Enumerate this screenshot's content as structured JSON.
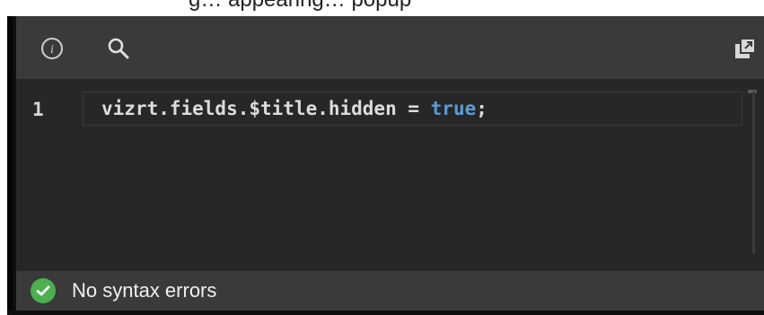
{
  "top_strip": {
    "text": "g… appearing… popup"
  },
  "toolbar": {
    "info_icon": "info-icon",
    "search_icon": "search-icon",
    "popout_icon": "popout-icon"
  },
  "editor": {
    "line_numbers": [
      "1"
    ],
    "code": {
      "prefix": "vizrt.fields.$title.hidden = ",
      "keyword": "true",
      "suffix": ";"
    }
  },
  "status": {
    "icon": "check-circle-icon",
    "text": "No syntax errors",
    "color_ok": "#4caf50"
  },
  "colors": {
    "panel_bg": "#0f0f10",
    "toolbar_bg": "#3a3a3a",
    "editor_bg": "#272727",
    "keyword": "#5b9bd5"
  }
}
